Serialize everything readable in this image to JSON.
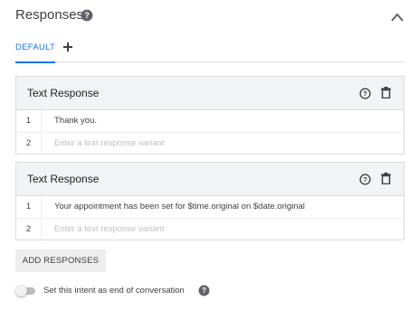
{
  "section": {
    "title": "Responses",
    "help_icon": "help-circle-icon",
    "collapse_icon": "chevron-up-icon"
  },
  "tabs": {
    "default_label": "DEFAULT",
    "add_icon": "plus-icon",
    "accent_color": "#1a73e8"
  },
  "cards": [
    {
      "title": "Text Response",
      "rows": [
        {
          "num": "1",
          "text": "Thank you.",
          "placeholder": ""
        },
        {
          "num": "2",
          "text": "",
          "placeholder": "Enter a text response variant"
        }
      ]
    },
    {
      "title": "Text Response",
      "rows": [
        {
          "num": "1",
          "text": "Your appointment has been set for $time.original on $date.original",
          "placeholder": ""
        },
        {
          "num": "2",
          "text": "",
          "placeholder": "Enter a text response variant"
        }
      ]
    }
  ],
  "add_responses_label": "ADD RESPONSES",
  "end_conversation": {
    "label": "Set this intent as end of conversation",
    "enabled": false
  }
}
